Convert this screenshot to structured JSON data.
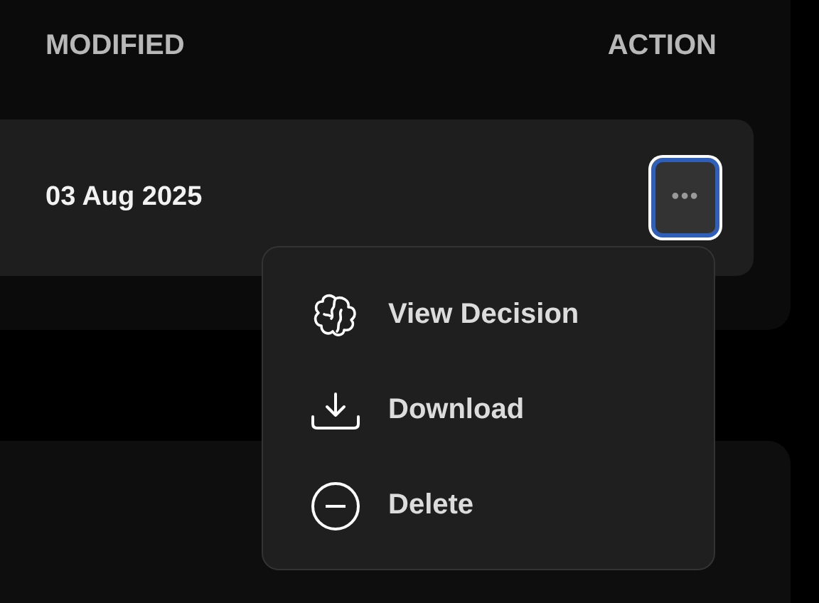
{
  "table": {
    "columns": [
      {
        "label": "MODIFIED"
      },
      {
        "label": "ACTION"
      }
    ],
    "rows": [
      {
        "modified": "03 Aug 2025",
        "action_button": {
          "label": "•••",
          "expanded": true
        }
      }
    ]
  },
  "actions_menu": {
    "items": [
      {
        "kind": "brain",
        "label": "View Decision"
      },
      {
        "kind": "download",
        "label": "Download"
      },
      {
        "kind": "delete",
        "label": "Delete"
      }
    ]
  }
}
